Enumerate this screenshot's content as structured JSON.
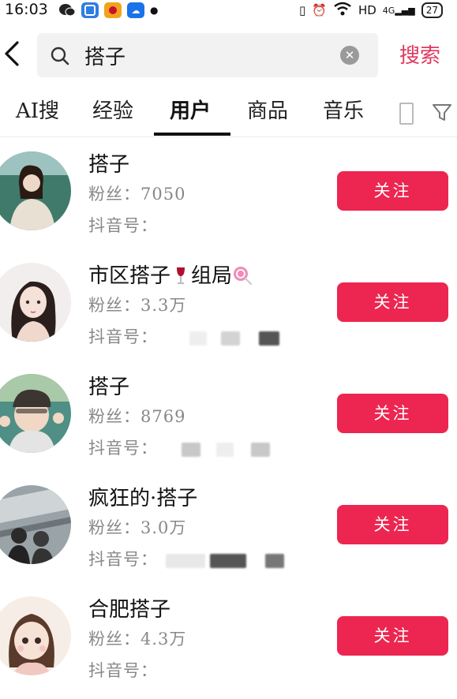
{
  "status": {
    "time": "16:03",
    "network": "HD",
    "signal": "4G",
    "battery": "27"
  },
  "search": {
    "query": "搭子",
    "button": "搜索"
  },
  "tabs": [
    {
      "label": "AI搜"
    },
    {
      "label": "经验"
    },
    {
      "label": "用户"
    },
    {
      "label": "商品"
    },
    {
      "label": "音乐"
    }
  ],
  "users": [
    {
      "name": "搭子",
      "fans": "粉丝：7050",
      "id_label": "抖音号：",
      "follow": "关注"
    },
    {
      "name": "市区搭子",
      "name_mid": "组局",
      "fans": "粉丝：3.3万",
      "id_label": "抖音号：",
      "follow": "关注"
    },
    {
      "name": "搭子",
      "fans": "粉丝：8769",
      "id_label": "抖音号：",
      "follow": "关注"
    },
    {
      "name": "疯狂的·搭子",
      "fans": "粉丝：3.0万",
      "id_label": "抖音号：",
      "follow": "关注"
    },
    {
      "name": "合肥搭子",
      "fans": "粉丝：4.3万",
      "id_label": "抖音号：",
      "follow": "关注"
    }
  ],
  "colors": {
    "accent": "#ec2650",
    "search_btn": "#e0385c"
  }
}
